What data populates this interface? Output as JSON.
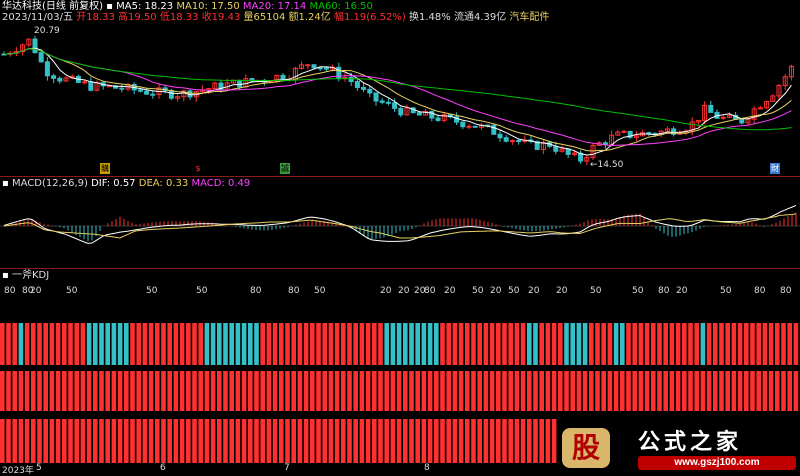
{
  "header": {
    "stock_name": "华达科技(日线 前复权)",
    "ma5": "MA5: 18.23",
    "ma10": "MA10: 17.50",
    "ma20": "MA20: 17.14",
    "ma60": "MA60: 16.50"
  },
  "quote": {
    "date": "2023/11/03/五",
    "open": "开18.33",
    "high": "高19.50",
    "low": "低18.33",
    "close": "收19.43",
    "volume": "量65104",
    "amount": "额1.24亿",
    "change": "幅1.19(6.52%)",
    "turnover": "换1.48%",
    "float_cap": "流通4.39亿",
    "sector": "汽车配件"
  },
  "price_chart": {
    "high_label": "20.79",
    "low_label": "14.50",
    "event_tags": [
      "購",
      "$",
      "誠",
      "財"
    ]
  },
  "macd": {
    "title": "MACD(12,26,9)",
    "dif": "DIF: 0.57",
    "dea": "DEA: 0.33",
    "macd": "MACD: 0.49"
  },
  "kdj": {
    "title": "一斧KDJ",
    "levels": [
      "80",
      "80",
      "20",
      "50",
      "50",
      "50",
      "80",
      "80",
      "50",
      "20",
      "20",
      "20",
      "80",
      "20",
      "50",
      "20",
      "50",
      "20",
      "20",
      "50",
      "50",
      "80",
      "20",
      "50",
      "80",
      "80"
    ]
  },
  "time_axis": {
    "labels": [
      "2023年",
      "5",
      "6",
      "7",
      "8"
    ]
  },
  "watermark": {
    "logo_char": "股",
    "site_name": "公式之家",
    "url": "www.gszj100.com"
  },
  "colors": {
    "up": "#ff3030",
    "down": "#35c0c8",
    "ma5": "#ffffff",
    "ma10": "#e8d060",
    "ma20": "#ff40ff",
    "ma60": "#00c000",
    "grid": "#8b1a1a"
  },
  "strip_pattern": "RRRCRRRRRRRRRRCCCCCCCRRRRRRRRRRRRCCCCCCCCCRRRRRRRRRRRRRRRRRRRRCCCCCCCCCRRRRRRRRRRRRRRCCRRRRCCCCRRRRCCRRRRRRRRRRRRCRRRRRRRRRRRRRRRRRRRRRRRRRRRRRRRRRRRRRRRRRRRRRRRRRRRRRRRRRCCCCCCCCCRRRRRRRRRRRRRRRRRRRRRRRRRRRRRRRRRRRRRRRRCCRRRR"
}
